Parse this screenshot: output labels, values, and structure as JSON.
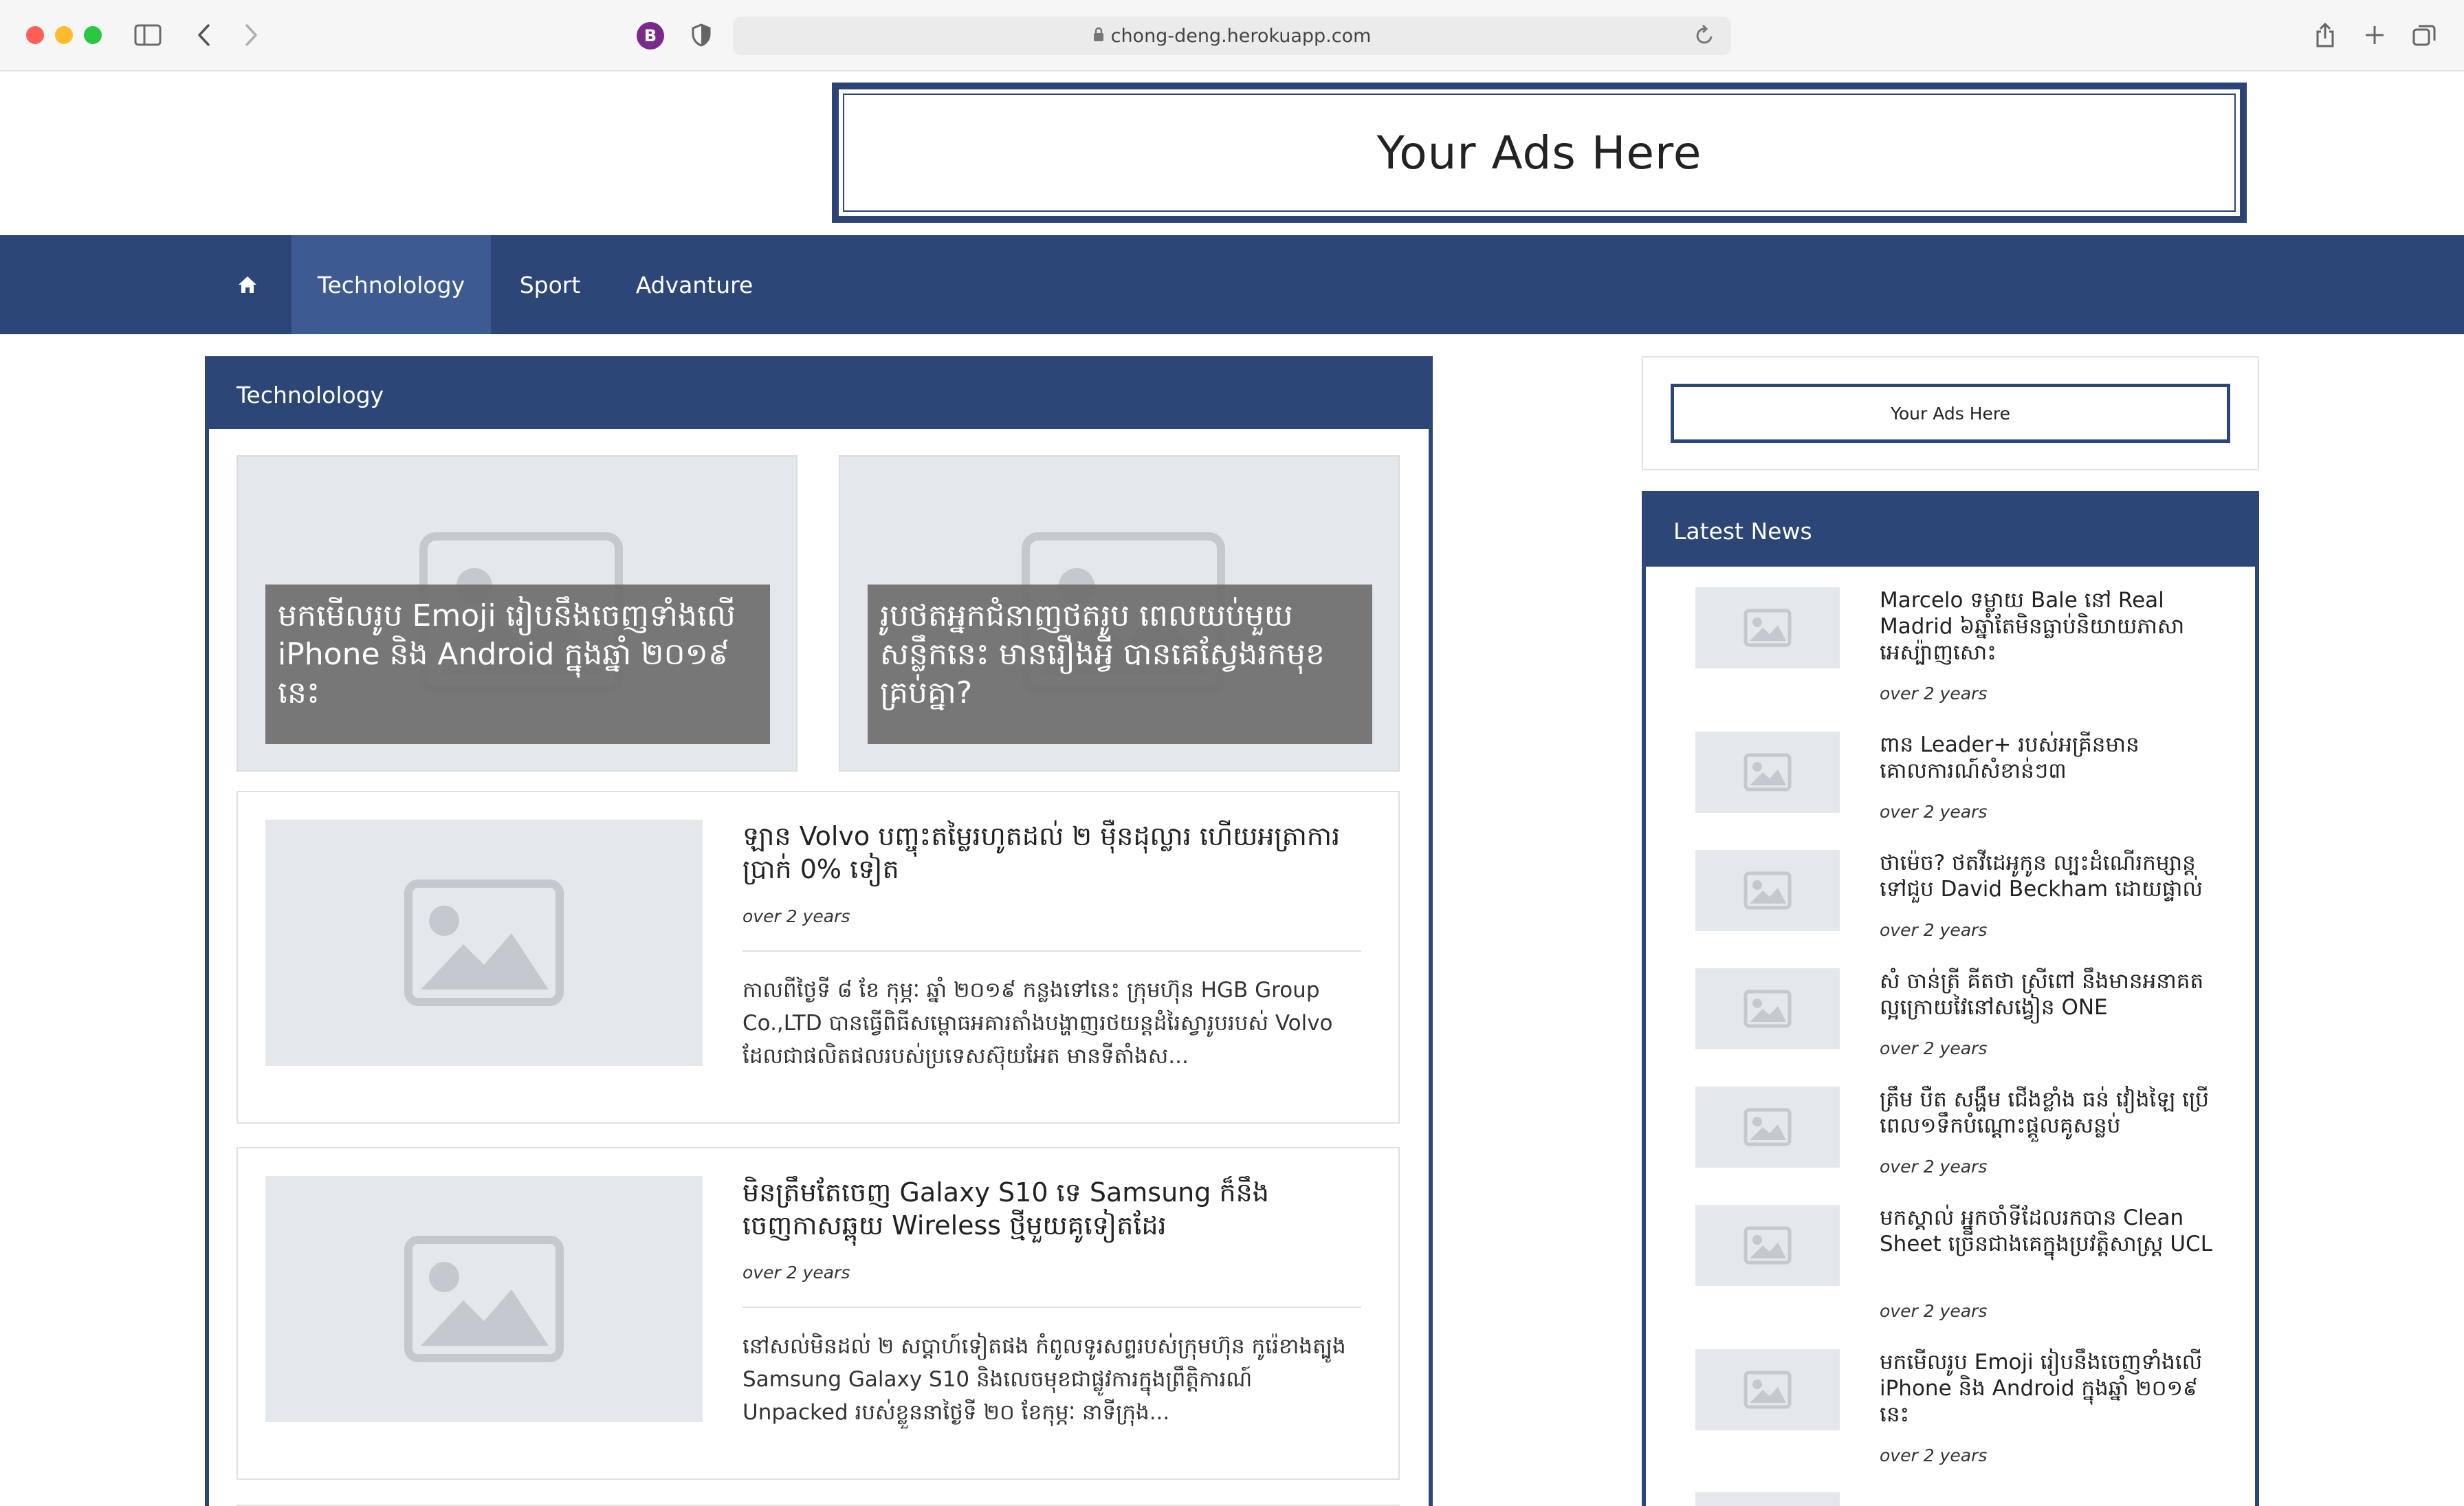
{
  "browser": {
    "url": "chong-deng.herokuapp.com",
    "extension_letter": "B",
    "accent": "#7a2a8a"
  },
  "banner_ad": {
    "text": "Your Ads Here"
  },
  "nav": {
    "home_icon": "home-icon",
    "items": [
      {
        "label": "Technolology",
        "active": true
      },
      {
        "label": "Sport",
        "active": false
      },
      {
        "label": "Advanture",
        "active": false
      }
    ]
  },
  "main": {
    "heading": "Technolology",
    "featured": [
      {
        "title": "មកមើលរូប Emoji រៀបនឹងចេញទាំងលើ iPhone និង Android ក្នុងឆ្នាំ ២០១៩ នេះ"
      },
      {
        "title": "រូបថតអ្នកជំនាញថតរូប ពេលយប់មួយសន្លឹកនេះ មានរឿងអ្វី បានគេស្វែងរកមុខគ្រប់គ្នា?"
      }
    ],
    "articles": [
      {
        "title": "ឡាន Volvo បញ្ចុះតម្លៃរហូតដល់ ២ ម៉ឺនដុល្លារ ហើយអត្រាការប្រាក់ 0% ទៀត",
        "time": "over 2 years",
        "excerpt": "កាលពីថ្ងៃទី ៨ ខែ កុម្ភៈ ឆ្នាំ ២០១៩ កន្លងទៅនេះ ក្រុមហ៊ុន HGB Group Co.,LTD បានធ្វើពិធីសម្ពោធអគារតាំងបង្ហាញរថយន្តដំរៃស្វារូបរបស់ Volvo ដែលជាផលិតផលរបស់ប្រទេសស៊ុយអែត មានទីតាំងស..."
      },
      {
        "title": "មិនត្រឹមតែចេញ Galaxy S10 ទេ Samsung ក៏នឹងចេញកាសឆ្ពុយ Wireless ថ្មីមួយគូទៀតដែរ",
        "time": "over 2 years",
        "excerpt": "នៅសល់មិនដល់ ២ សប្តាហ៍ទៀតផង កំពូលទូរសព្ទរបស់ក្រុមហ៊ុន កូរ៉េខាងត្បូង Samsung Galaxy S10 និងលេចមុខជាផ្លូវការក្នុងព្រឹត្តិការណ៍ Unpacked របស់ខ្លួននាថ្ងៃទី ២០ ខែកុម្ភៈ នាទីក្រុង..."
      }
    ]
  },
  "sidebar": {
    "ad_text": "Your Ads Here",
    "latest_heading": "Latest News",
    "news": [
      {
        "title": "Marcelo ទម្លាយ Bale នៅ Real Madrid ៦ឆ្នាំតែមិនធ្លាប់និយាយភាសាអេស្ប៉ាញសោះ",
        "time": "over 2 years"
      },
      {
        "title": "ពាន Leader+ របស់អគ្រីនមានគោលការណ៍សំខាន់ៗ៣",
        "time": "over 2 years"
      },
      {
        "title": "ថាម៉េច? ថតវីដេអូកូន ល្បះដំណើរកម្សាន្តទៅជួប David Beckham ដោយផ្ទាល់",
        "time": "over 2 years"
      },
      {
        "title": "សំ ចាន់ត្រី គីតថា ស្រីពៅ នឹងមានអនាគតល្អក្រោយវៃនៅសង្វៀន ONE",
        "time": "over 2 years"
      },
      {
        "title": "ត្រឹម បឺត សង្ហឹម ជើងខ្លាំង ធន់ វៀងឡៃ ប្រើពេល១ទឹកបំណ្ដោះផ្តួលគូសន្លប់",
        "time": "over 2 years"
      },
      {
        "title": "មកស្គាល់ អ្នកចាំទីដែលរកបាន Clean Sheet ច្រើនជាងគេក្នុងប្រវត្តិសាស្ត្រ UCL",
        "time": "over 2 years"
      },
      {
        "title": "មកមើលរូប Emoji រៀបនឹងចេញទាំងលើ iPhone និង Android ក្នុងឆ្នាំ ២០១៩ នេះ",
        "time": "over 2 years"
      }
    ]
  },
  "colors": {
    "brand": "#2c4677",
    "nav_active": "#3d5a92",
    "placeholder_bg": "#e4e7ec",
    "placeholder_icon": "#c5c9cf"
  }
}
